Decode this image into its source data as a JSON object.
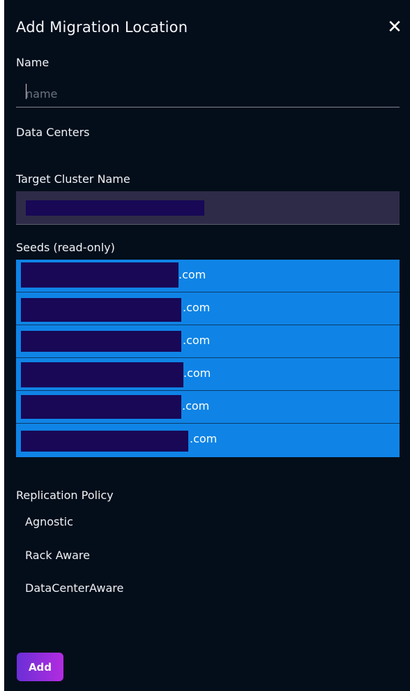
{
  "dialog": {
    "title": "Add Migration Location",
    "close_label": "✕"
  },
  "form": {
    "name_label": "Name",
    "name_placeholder": "name",
    "name_value": "",
    "data_centers_label": "Data Centers",
    "target_cluster_label": "Target Cluster Name",
    "seeds_label": "Seeds (read-only)",
    "seeds": [
      {
        "suffix": ".com"
      },
      {
        "suffix": ".com"
      },
      {
        "suffix": ".com"
      },
      {
        "suffix": ".com"
      },
      {
        "suffix": ".com"
      },
      {
        "suffix": ".com"
      }
    ],
    "replication_policy_label": "Replication Policy",
    "replication_options": [
      "Agnostic",
      "Rack Aware",
      "DataCenterAware"
    ]
  },
  "actions": {
    "add_label": "Add"
  },
  "colors": {
    "background": "#040e1a",
    "seeds_highlight": "#0f84e6",
    "redaction": "#180856",
    "target_field": "#2e2b48",
    "button_gradient_start": "#6a2fd6",
    "button_gradient_end": "#b32ce0"
  }
}
